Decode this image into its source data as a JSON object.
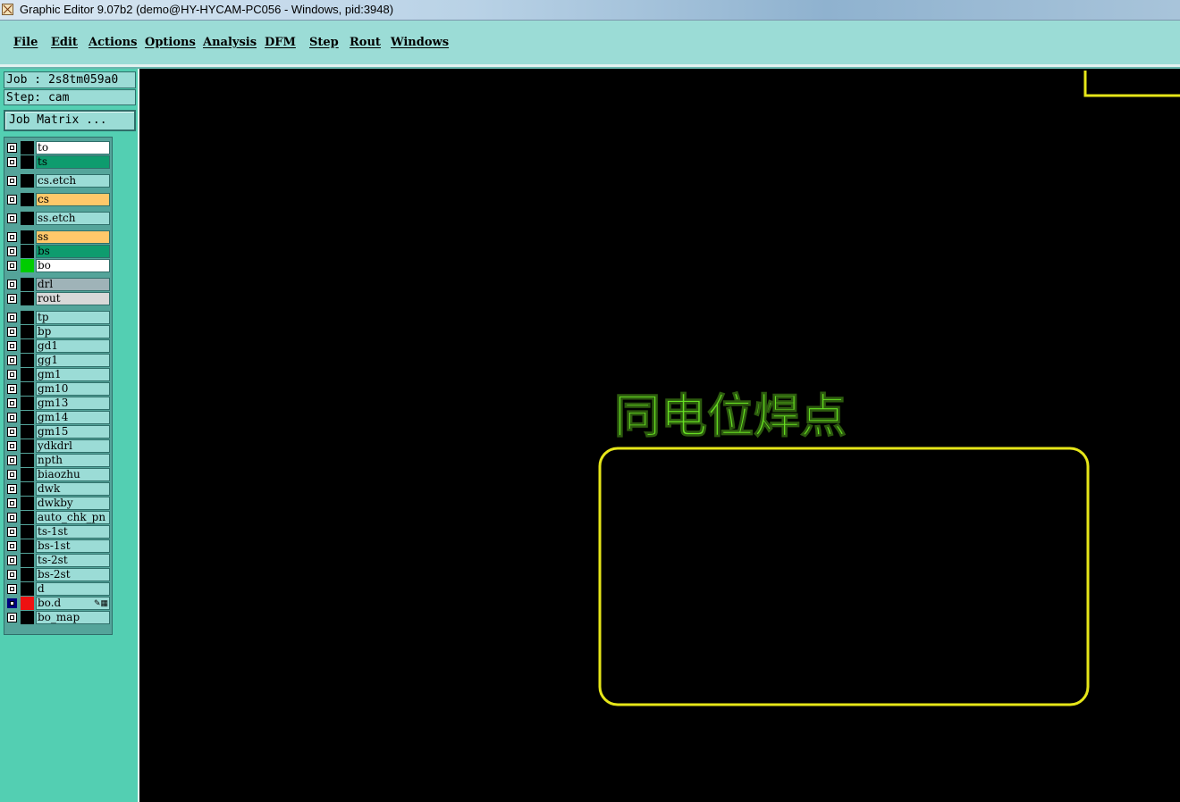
{
  "window": {
    "title": "Graphic Editor 9.07b2 (demo@HY-HYCAM-PC056 - Windows, pid:3948)"
  },
  "menu": [
    "File",
    "Edit",
    "Actions",
    "Options",
    "Analysis",
    "DFM",
    "Step",
    "Rout",
    "Windows"
  ],
  "sidebar": {
    "job": "Job : 2s8tm059a0",
    "step": "Step: cam",
    "job_matrix_button": "Job Matrix ..."
  },
  "layers": [
    {
      "name": "to",
      "bg": "#ffffff",
      "swatch": "#000000",
      "checkbox": "#000000"
    },
    {
      "name": "ts",
      "bg": "#0e9c6e",
      "swatch": "#000000",
      "checkbox": "#000000"
    },
    {
      "name": "cs.etch",
      "bg": "#9bdcd6",
      "swatch": "#000000",
      "checkbox": "#000000"
    },
    {
      "name": "cs",
      "bg": "#ffc86a",
      "swatch": "#000000",
      "checkbox": "#000000"
    },
    {
      "name": "ss.etch",
      "bg": "#9bdcd6",
      "swatch": "#000000",
      "checkbox": "#000000"
    },
    {
      "name": "ss",
      "bg": "#ffc86a",
      "swatch": "#000000",
      "checkbox": "#000000"
    },
    {
      "name": "bs",
      "bg": "#0e9c6e",
      "swatch": "#000000",
      "checkbox": "#000000"
    },
    {
      "name": "bo",
      "bg": "#ffffff",
      "swatch": "#00cc00",
      "checkbox": "#000000"
    },
    {
      "name": "drl",
      "bg": "#9fb3b8",
      "swatch": "#000000",
      "checkbox": "#000000"
    },
    {
      "name": "rout",
      "bg": "#d8d8d8",
      "swatch": "#000000",
      "checkbox": "#000000"
    },
    {
      "name": "tp",
      "bg": "#9bdcd6",
      "swatch": "#000000",
      "checkbox": "#000000"
    },
    {
      "name": "bp",
      "bg": "#9bdcd6",
      "swatch": "#000000",
      "checkbox": "#000000"
    },
    {
      "name": "gd1",
      "bg": "#9bdcd6",
      "swatch": "#000000",
      "checkbox": "#000000"
    },
    {
      "name": "gg1",
      "bg": "#9bdcd6",
      "swatch": "#000000",
      "checkbox": "#000000"
    },
    {
      "name": "gm1",
      "bg": "#9bdcd6",
      "swatch": "#000000",
      "checkbox": "#000000"
    },
    {
      "name": "gm10",
      "bg": "#9bdcd6",
      "swatch": "#000000",
      "checkbox": "#000000"
    },
    {
      "name": "gm13",
      "bg": "#9bdcd6",
      "swatch": "#000000",
      "checkbox": "#000000"
    },
    {
      "name": "gm14",
      "bg": "#9bdcd6",
      "swatch": "#000000",
      "checkbox": "#000000"
    },
    {
      "name": "gm15",
      "bg": "#9bdcd6",
      "swatch": "#000000",
      "checkbox": "#000000"
    },
    {
      "name": "ydkdrl",
      "bg": "#9bdcd6",
      "swatch": "#000000",
      "checkbox": "#000000"
    },
    {
      "name": "npth",
      "bg": "#9bdcd6",
      "swatch": "#000000",
      "checkbox": "#000000"
    },
    {
      "name": "biaozhu",
      "bg": "#9bdcd6",
      "swatch": "#000000",
      "checkbox": "#000000"
    },
    {
      "name": "dwk",
      "bg": "#9bdcd6",
      "swatch": "#000000",
      "checkbox": "#000000"
    },
    {
      "name": "dwkby",
      "bg": "#9bdcd6",
      "swatch": "#000000",
      "checkbox": "#000000"
    },
    {
      "name": "auto_chk_pn",
      "bg": "#9bdcd6",
      "swatch": "#000000",
      "checkbox": "#000000"
    },
    {
      "name": "ts-1st",
      "bg": "#9bdcd6",
      "swatch": "#000000",
      "checkbox": "#000000"
    },
    {
      "name": "bs-1st",
      "bg": "#9bdcd6",
      "swatch": "#000000",
      "checkbox": "#000000"
    },
    {
      "name": "ts-2st",
      "bg": "#9bdcd6",
      "swatch": "#000000",
      "checkbox": "#000000"
    },
    {
      "name": "bs-2st",
      "bg": "#9bdcd6",
      "swatch": "#000000",
      "checkbox": "#000000"
    },
    {
      "name": "d",
      "bg": "#9bdcd6",
      "swatch": "#000000",
      "checkbox": "#000000"
    },
    {
      "name": "bo.d",
      "bg": "#9bdcd6",
      "swatch": "#ee1111",
      "checkbox": "#000080",
      "work_icon": "✎▦"
    },
    {
      "name": "bo_map",
      "bg": "#9bdcd6",
      "swatch": "#000000",
      "checkbox": "#000000"
    }
  ],
  "canvas": {
    "label_text": "同电位焊点",
    "label_color": "#66dd22",
    "outline_color": "#e6e619",
    "background": "#000000"
  }
}
